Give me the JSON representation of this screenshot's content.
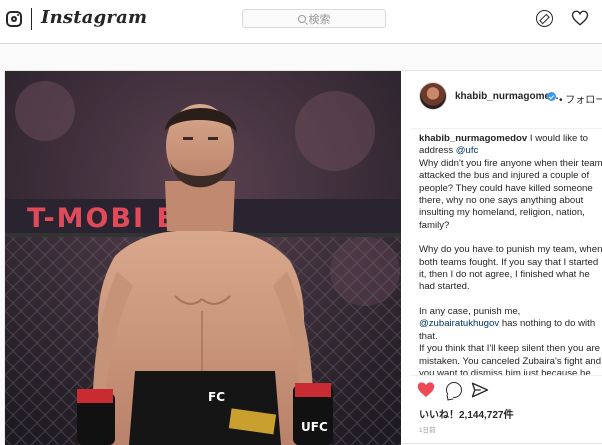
{
  "app": {
    "wordmark": "Instagram",
    "search_placeholder": "検索"
  },
  "icons": {
    "logo": "instagram-camera-icon",
    "explore": "compass-icon",
    "activity": "heart-icon",
    "like": "heart-filled-icon",
    "comment": "comment-icon",
    "share": "share-icon",
    "verified": "verified-badge-icon"
  },
  "colors": {
    "like_red": "#ed4956",
    "verified_blue": "#3897f0",
    "mention_blue": "#003569"
  },
  "post": {
    "photo_banner_text": "T-MOBI      ENA",
    "shorts_brand": "FC",
    "glove_brand": "UFC",
    "header": {
      "username": "khabib_nurmagome...",
      "follow": "• フォロー"
    },
    "caption": {
      "username": "khabib_nurmagomedov",
      "p1_text": " I would like to address ",
      "p1_mention": "@ufc",
      "p2": "Why didn't you fire anyone when their team attacked the bus and injured a couple of people? They could have killed someone there, why no one says anything about insulting my homeland, religion, nation, family?",
      "p3": "Why do you have to punish my team, when both teams fought. If you say that I started it, then I do not agree, I finished what he had started.",
      "p4_pre": "In any case, punish me, ",
      "p4_mention": "@zubairatukhugov",
      "p4_post": " has nothing to do with that.",
      "p5": "If you think that I'll keep silent then you are mistaken. You canceled Zubaira's fight and you want to dismiss him just because he hit Conor. But don't forget that it was Conor"
    },
    "likes": "いいね！2,144,727件",
    "timestamp": "1日前"
  }
}
